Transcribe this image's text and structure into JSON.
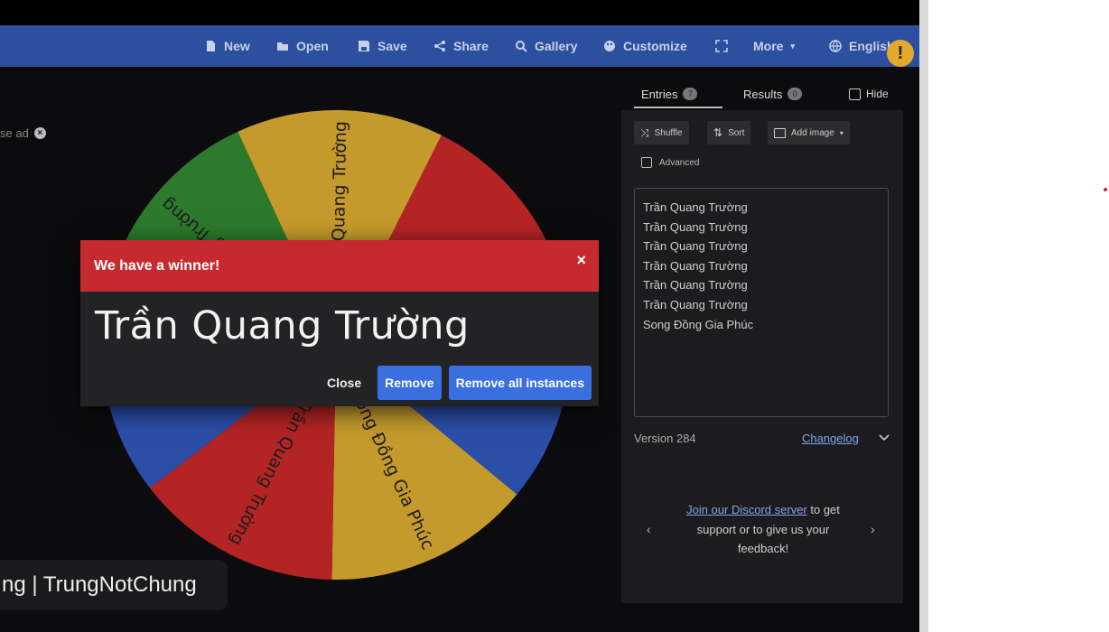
{
  "nav": {
    "items": [
      {
        "label": "New",
        "icon": "file-icon"
      },
      {
        "label": "Open",
        "icon": "folder-icon"
      },
      {
        "label": "Save",
        "icon": "save-icon"
      },
      {
        "label": "Share",
        "icon": "share-icon"
      },
      {
        "label": "Gallery",
        "icon": "search-icon"
      },
      {
        "label": "Customize",
        "icon": "palette-icon"
      },
      {
        "label": "",
        "icon": "fullscreen-icon"
      },
      {
        "label": "More",
        "icon": "caret-down-icon"
      },
      {
        "label": "English",
        "icon": "globe-icon"
      }
    ],
    "alert": "!"
  },
  "ad_note": "se ad",
  "wheel": {
    "segments": [
      {
        "label": "Trần Quang Trường",
        "color": "#c49a2c"
      },
      {
        "label": "",
        "color": "#b42424"
      },
      {
        "label": "Trần Quang Trường",
        "color": "#2b4ea8"
      },
      {
        "label": "Song Đồng Gia Phúc",
        "color": "#c49a2c"
      },
      {
        "label": "Trần Quang Trường",
        "color": "#b42424"
      },
      {
        "label": "",
        "color": "#2b4ea8"
      },
      {
        "label": "Trần Quang Trường",
        "color": "#2c7a2c"
      }
    ]
  },
  "watermark": "ng | TrungNotChung",
  "modal": {
    "title": "We have a winner!",
    "close_icon": "×",
    "winner": "Trần Quang Trường",
    "close_label": "Close",
    "remove_label": "Remove",
    "remove_all_label": "Remove all instances"
  },
  "tabs": {
    "entries_label": "Entries",
    "entries_count": "7",
    "results_label": "Results",
    "results_count": "0",
    "hide_label": "Hide"
  },
  "toolbar": {
    "shuffle_label": "Shuffle",
    "sort_label": "Sort",
    "add_image_label": "Add image",
    "advanced_label": "Advanced"
  },
  "entries": [
    "Trần Quang Trường",
    "Trần Quang Trường",
    "Trần Quang Trường",
    "Trần Quang Trường",
    "Trần Quang Trường",
    "Trần Quang Trường",
    "Song Đồng Gia Phúc"
  ],
  "footer": {
    "version": "Version 284",
    "changelog": "Changelog",
    "discord_link": "Join our Discord server",
    "discord_text_1": " to get",
    "discord_text_2": "support or to give us your",
    "discord_text_3": "feedback!"
  }
}
